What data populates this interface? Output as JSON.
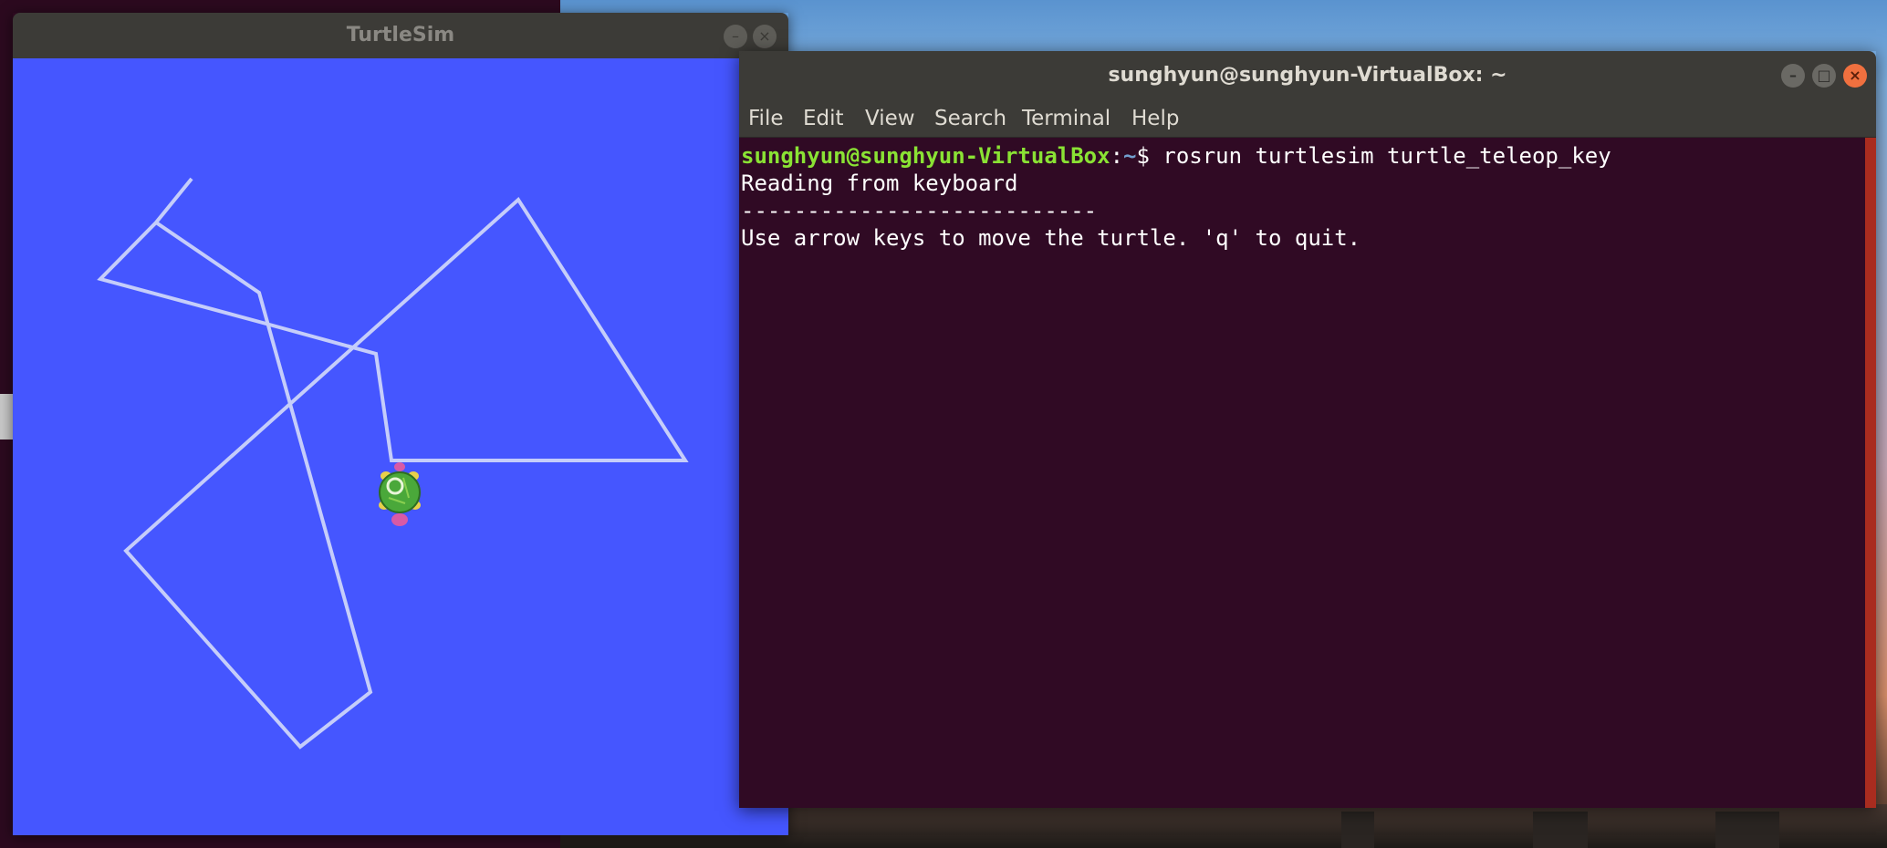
{
  "turtlesim": {
    "title": "TurtleSim",
    "minimize_icon": "minimize-icon",
    "close_icon": "close-icon",
    "background_color": "#4556ff",
    "path_color": "#c5cdfa"
  },
  "terminal": {
    "title": "sunghyun@sunghyun-VirtualBox: ~",
    "menu": [
      "File",
      "Edit",
      "View",
      "Search",
      "Terminal",
      "Help"
    ],
    "prompt_user": "sunghyun@sunghyun-VirtualBox",
    "prompt_sep": ":",
    "prompt_path": "~",
    "prompt_symbol": "$",
    "command": " rosrun turtlesim turtle_teleop_key",
    "output": [
      "Reading from keyboard",
      "---------------------------",
      "Use arrow keys to move the turtle. 'q' to quit."
    ],
    "background_color": "#300a24",
    "prompt_color": "#8ae234"
  }
}
